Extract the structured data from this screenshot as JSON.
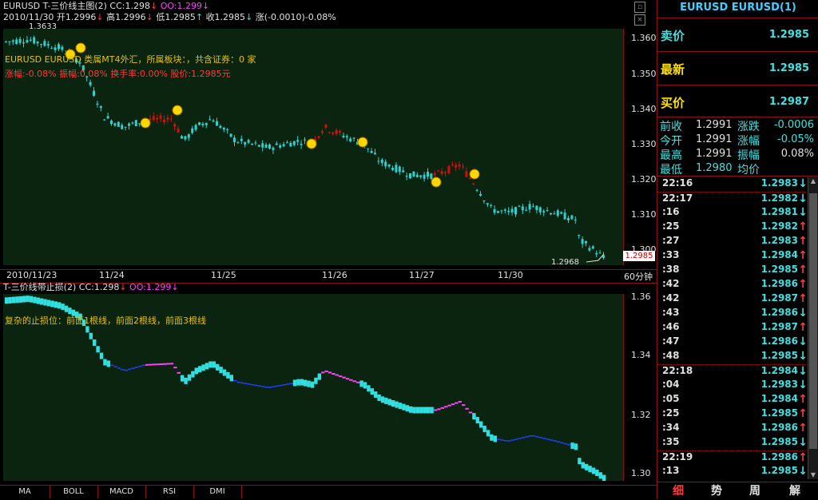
{
  "main": {
    "title": "EURUSD T-三价线主图(2)",
    "cc_label": "CC:1.298",
    "oo_label": "OO:1.299",
    "ohlc": {
      "date": "2010/11/30",
      "open": "开1.2996",
      "high": "高1.2996",
      "low": "低1.2985",
      "close": "收1.2985",
      "change": "涨(-0.0010)-0.08%"
    },
    "info_line1": "EURUSD EURUSD 类属MT4外汇，所属板块：，共含证券：0 家",
    "info_line2": "涨幅:-0.08% 振幅:0.08% 换手率:0.00% 股价:1.2985元",
    "top_label": "1.3633",
    "low_label": "1.2968",
    "last_price_tag": "1.2985",
    "period": "60分钟",
    "yticks": [
      "1.3600",
      "1.3500",
      "1.3400",
      "1.3300",
      "1.3200",
      "1.3100",
      "1.3000"
    ],
    "xticks": [
      "2010/11/23",
      "11/24",
      "11/25",
      "11/26",
      "11/27",
      "11/30"
    ]
  },
  "sub": {
    "title": "T-三价线带止损(2)",
    "cc_label": "CC:1.298",
    "oo_label": "OO:1.299",
    "note": "复杂的止损位：前面1根线，前面2根线，前面3根线",
    "yticks": [
      "1.36",
      "1.34",
      "1.32",
      "1.30"
    ]
  },
  "tabs": [
    "MA",
    "BOLL",
    "MACD",
    "RSI",
    "DMI"
  ],
  "quote": {
    "title": "EURUSD EURUSD(1)",
    "sell_label": "卖价",
    "sell_value": "1.2985",
    "last_label": "最新",
    "last_value": "1.2985",
    "buy_label": "买价",
    "buy_value": "1.2987",
    "stats": [
      {
        "label": "前收",
        "value": "1.2991",
        "label2": "涨跌",
        "value2": "-0.0006"
      },
      {
        "label": "今开",
        "value": "1.2991",
        "label2": "涨幅",
        "value2": "-0.05%"
      },
      {
        "label": "最高",
        "value": "1.2991",
        "label2": "振幅",
        "value2": "0.08%"
      },
      {
        "label": "最低",
        "value": "1.2980",
        "label2": "均价",
        "value2": ""
      }
    ],
    "ticks": [
      {
        "t": "22:16",
        "p": "1.2983",
        "d": "down"
      },
      {
        "t": "22:17",
        "p": "1.2982",
        "d": "down"
      },
      {
        "t": ":16",
        "p": "1.2981",
        "d": "down"
      },
      {
        "t": ":25",
        "p": "1.2982",
        "d": "up"
      },
      {
        "t": ":27",
        "p": "1.2983",
        "d": "up"
      },
      {
        "t": ":33",
        "p": "1.2984",
        "d": "up"
      },
      {
        "t": ":38",
        "p": "1.2985",
        "d": "up"
      },
      {
        "t": ":42",
        "p": "1.2986",
        "d": "up"
      },
      {
        "t": ":42",
        "p": "1.2987",
        "d": "up"
      },
      {
        "t": ":43",
        "p": "1.2986",
        "d": "down"
      },
      {
        "t": ":46",
        "p": "1.2987",
        "d": "up"
      },
      {
        "t": ":47",
        "p": "1.2986",
        "d": "down"
      },
      {
        "t": ":48",
        "p": "1.2985",
        "d": "down"
      },
      {
        "t": "22:18",
        "p": "1.2984",
        "d": "down"
      },
      {
        "t": ":04",
        "p": "1.2983",
        "d": "down"
      },
      {
        "t": ":05",
        "p": "1.2984",
        "d": "up"
      },
      {
        "t": ":25",
        "p": "1.2985",
        "d": "up"
      },
      {
        "t": ":34",
        "p": "1.2986",
        "d": "up"
      },
      {
        "t": ":35",
        "p": "1.2985",
        "d": "down"
      },
      {
        "t": "22:19",
        "p": "1.2986",
        "d": "up"
      },
      {
        "t": ":13",
        "p": "1.2985",
        "d": "down"
      }
    ],
    "bottom_tabs": [
      "细",
      "势",
      "周",
      "解"
    ]
  },
  "colors": {
    "up": "#ff3b3b",
    "down": "#40e0e0",
    "plot_bg": "#0b2410",
    "frame": "#8b1010"
  }
}
